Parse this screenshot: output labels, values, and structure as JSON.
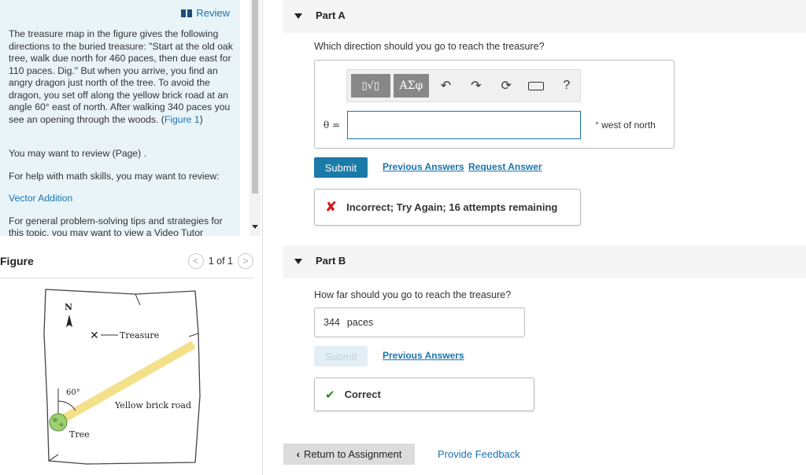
{
  "left_panel": {
    "review_label": "Review",
    "problem_text_before": "The treasure map in the figure gives the following directions to the buried treasure: \"Start at the old oak tree, walk due north for 460 paces, then due east for 110 paces. Dig.\" But when you arrive, you find an angry dragon just north of the tree. To avoid the dragon, you set off along the yellow brick road at an angle 60° east of north. After walking 340 paces you see an opening through the woods. (",
    "figure_link": "Figure 1",
    "problem_text_after": ")",
    "review_page": "You may want to review (Page) .",
    "math_help": "For help with math skills, you may want to review:",
    "vector_addition": "Vector Addition",
    "general_tips": "For general problem-solving tips and strategies for this topic, you may want to view a Video Tutor"
  },
  "figure": {
    "title": "Figure",
    "pager": "1 of 1",
    "prev": "<",
    "next": ">",
    "map_labels": {
      "north": "N",
      "treasure": "Treasure",
      "angle": "60°",
      "road": "Yellow brick road",
      "tree": "Tree"
    }
  },
  "part_a": {
    "label": "Part A",
    "question": "Which direction should you go to reach the treasure?",
    "toolbar": {
      "template_label": "▯√▯",
      "greek_label": "ΑΣφ",
      "undo": "↶",
      "redo": "↷",
      "reset": "⟳",
      "help": "?"
    },
    "variable_label": "θ =",
    "input_value": "",
    "unit": "° west of north",
    "submit": "Submit",
    "previous_answers": "Previous Answers",
    "request_answer": "Request Answer",
    "feedback": "Incorrect; Try Again; 16 attempts remaining"
  },
  "part_b": {
    "label": "Part B",
    "question": "How far should you go to reach the treasure?",
    "input_value": "344",
    "unit": "paces",
    "submit": "Submit",
    "previous_answers": "Previous Answers",
    "feedback": "Correct"
  },
  "footer": {
    "return_label": "Return to Assignment",
    "provide_feedback": "Provide Feedback"
  }
}
